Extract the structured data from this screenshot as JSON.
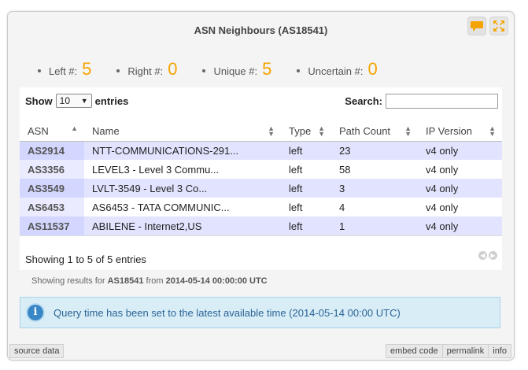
{
  "widget": {
    "title": "ASN Neighbours (AS18541)",
    "buttons": {
      "comment_icon": "speech-bubble-icon",
      "expand_icon": "fullscreen-icon"
    }
  },
  "stats": [
    {
      "label": "Left #:",
      "value": "5"
    },
    {
      "label": "Right #:",
      "value": "0"
    },
    {
      "label": "Unique #:",
      "value": "5"
    },
    {
      "label": "Uncertain #:",
      "value": "0"
    }
  ],
  "table": {
    "show_label": "Show",
    "show_value": "10",
    "entries_label": "entries",
    "search_label": "Search:",
    "search_value": "",
    "columns": [
      "ASN",
      "Name",
      "Type",
      "Path Count",
      "IP Version"
    ],
    "rows": [
      {
        "asn": "AS2914",
        "name": "NTT-COMMUNICATIONS-291...",
        "type": "left",
        "path_count": "23",
        "ip_version": "v4 only"
      },
      {
        "asn": "AS3356",
        "name": "LEVEL3 - Level 3 Commu...",
        "type": "left",
        "path_count": "58",
        "ip_version": "v4 only"
      },
      {
        "asn": "AS3549",
        "name": "LVLT-3549 - Level 3 Co...",
        "type": "left",
        "path_count": "3",
        "ip_version": "v4 only"
      },
      {
        "asn": "AS6453",
        "name": "AS6453 - TATA COMMUNIC...",
        "type": "left",
        "path_count": "4",
        "ip_version": "v4 only"
      },
      {
        "asn": "AS11537",
        "name": "ABILENE - Internet2,US",
        "type": "left",
        "path_count": "1",
        "ip_version": "v4 only"
      }
    ],
    "info": "Showing 1 to 5 of 5 entries"
  },
  "results_note": {
    "prefix": "Showing results for",
    "resource": "AS18541",
    "middle": "from",
    "time": "2014-05-14 00:00:00 UTC"
  },
  "alert": {
    "icon": "info-icon",
    "message": "Query time has been set to the latest available time (2014-05-14 00:00 UTC)"
  },
  "footer": {
    "source": "source data",
    "embed": "embed code",
    "permalink": "permalink",
    "info": "info"
  },
  "colors": {
    "accent": "#f5a300",
    "row_odd": "#e2e4ff",
    "alert_bg": "#d9edf7",
    "alert_text": "#2a6496"
  }
}
